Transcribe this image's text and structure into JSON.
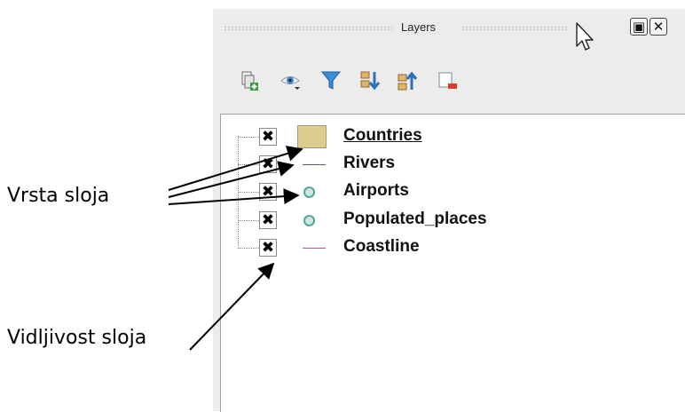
{
  "annotations": {
    "layer_type": "Vrsta  sloja",
    "layer_visibility": "Vidljivost sloja"
  },
  "panel": {
    "title": "Layers",
    "float_glyph": "▣",
    "close_glyph": "✕"
  },
  "toolbar": {
    "buttons": [
      {
        "icon": "add-group-icon"
      },
      {
        "icon": "eye-visibility-icon"
      },
      {
        "icon": "filter-icon"
      },
      {
        "icon": "expand-all-icon"
      },
      {
        "icon": "collapse-all-icon"
      },
      {
        "icon": "remove-layer-icon"
      }
    ]
  },
  "layers": [
    {
      "name": "Countries",
      "symbol": "polygon",
      "visible": true,
      "selected": true,
      "check": "✖"
    },
    {
      "name": "Rivers",
      "symbol": "line",
      "visible": true,
      "selected": false,
      "check": "✖"
    },
    {
      "name": "Airports",
      "symbol": "point",
      "visible": true,
      "selected": false,
      "check": "✖"
    },
    {
      "name": "Populated_places",
      "symbol": "point",
      "visible": true,
      "selected": false,
      "check": "✖"
    },
    {
      "name": "Coastline",
      "symbol": "line",
      "visible": true,
      "selected": false,
      "check": "✖"
    }
  ],
  "colors": {
    "polygon_fill": "#ddcc8e",
    "river_line": "#555a6e",
    "coast_line": "#b058a8",
    "point_fill": "#cde8e4",
    "point_stroke": "#57a39a"
  }
}
